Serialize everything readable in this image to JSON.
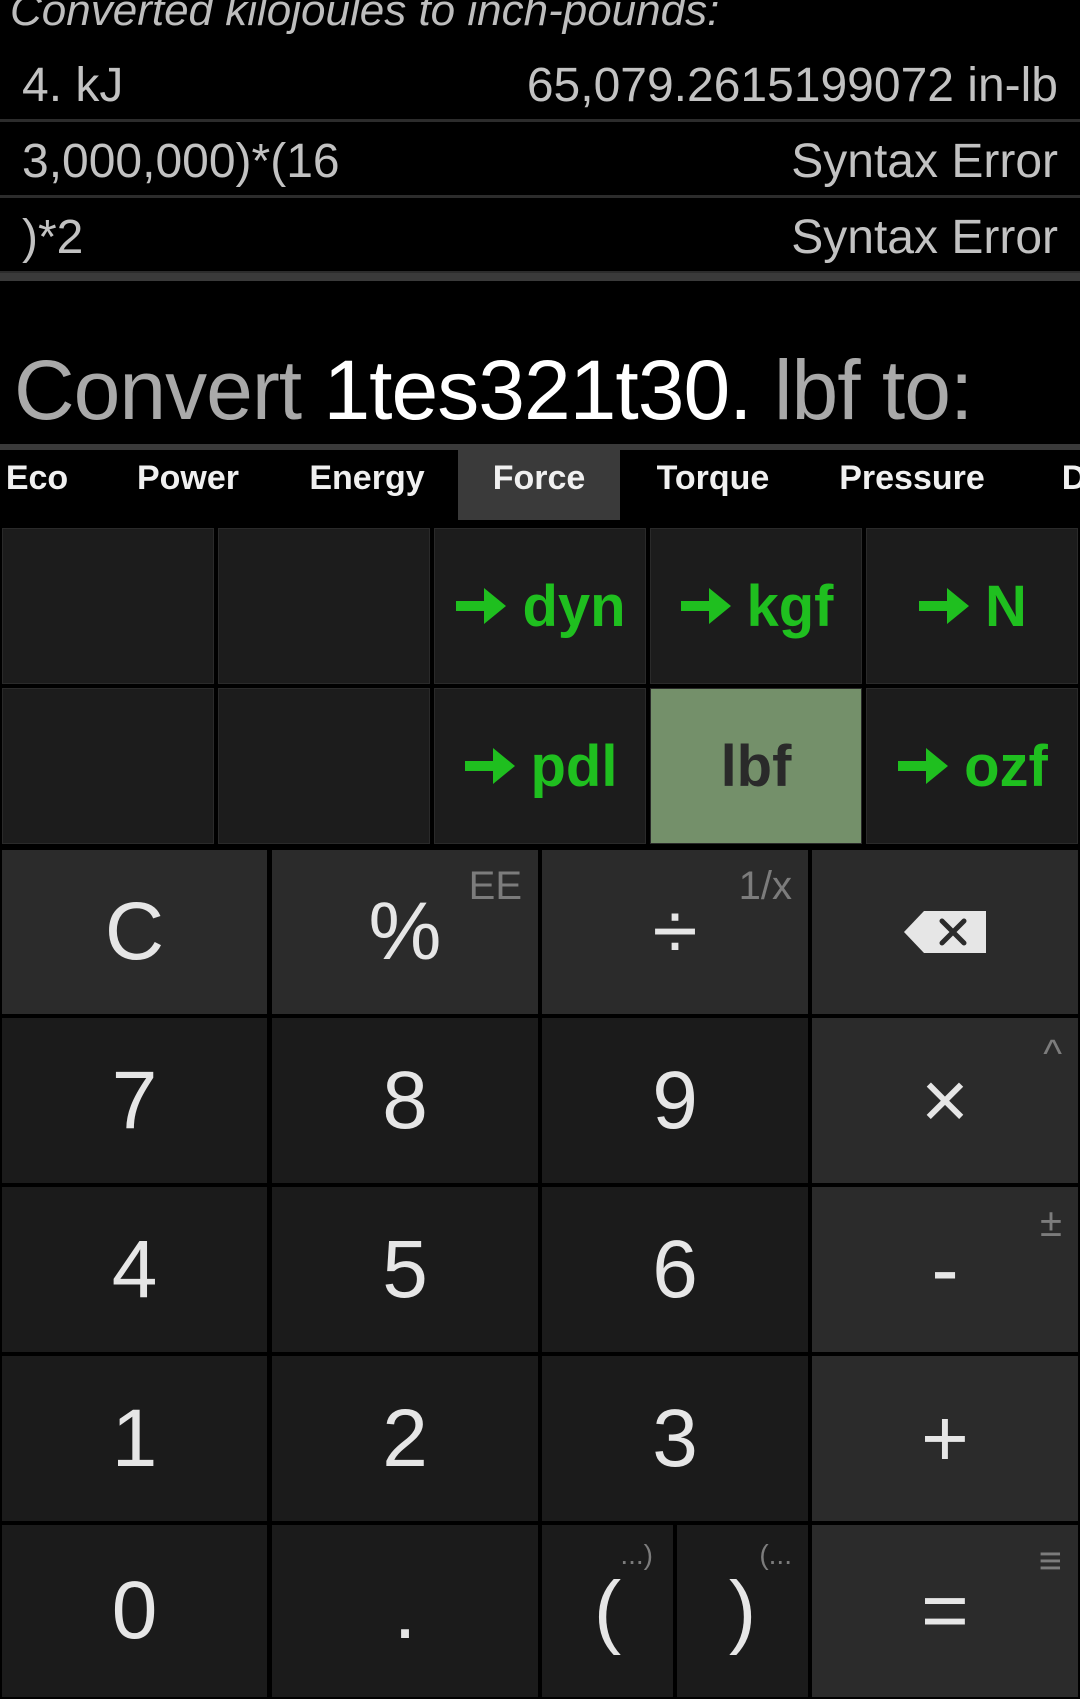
{
  "history": {
    "title": "Converted kilojoules to inch-pounds:",
    "rows": [
      {
        "expr": "4. kJ",
        "result": "65,079.2615199072 in-lb"
      },
      {
        "expr": "3,000,000)*(16",
        "result": "Syntax Error"
      },
      {
        "expr": ")*2",
        "result": "Syntax Error"
      }
    ]
  },
  "display": {
    "prefix": "Convert",
    "value": "1tes321t30.",
    "suffix": "lbf to:"
  },
  "tabs": [
    "Eco",
    "Power",
    "Energy",
    "Force",
    "Torque",
    "Pressure",
    "D"
  ],
  "active_tab": "Force",
  "units": {
    "row1": [
      "dyn",
      "kgf",
      "N"
    ],
    "row2_left": "pdl",
    "selected": "lbf",
    "row2_right": "ozf"
  },
  "keys": {
    "clear": "C",
    "percent": "%",
    "percent_sub": "EE",
    "divide": "÷",
    "divide_sub": "1/x",
    "seven": "7",
    "eight": "8",
    "nine": "9",
    "multiply": "×",
    "multiply_sub": "^",
    "four": "4",
    "five": "5",
    "six": "6",
    "minus": "-",
    "minus_sub": "±",
    "one": "1",
    "two": "2",
    "three": "3",
    "plus": "+",
    "zero": "0",
    "dot": ".",
    "lparen": "(",
    "lparen_sub": "...)",
    "rparen": ")",
    "rparen_sub": "(...",
    "equals": "=",
    "equals_sub": "≡"
  },
  "colors": {
    "unit_green": "#1fbf1f",
    "selected_unit_bg": "#74906a",
    "background": "#000000"
  },
  "icons": {
    "backspace": "backspace-icon",
    "arrow": "arrow-right-icon"
  }
}
